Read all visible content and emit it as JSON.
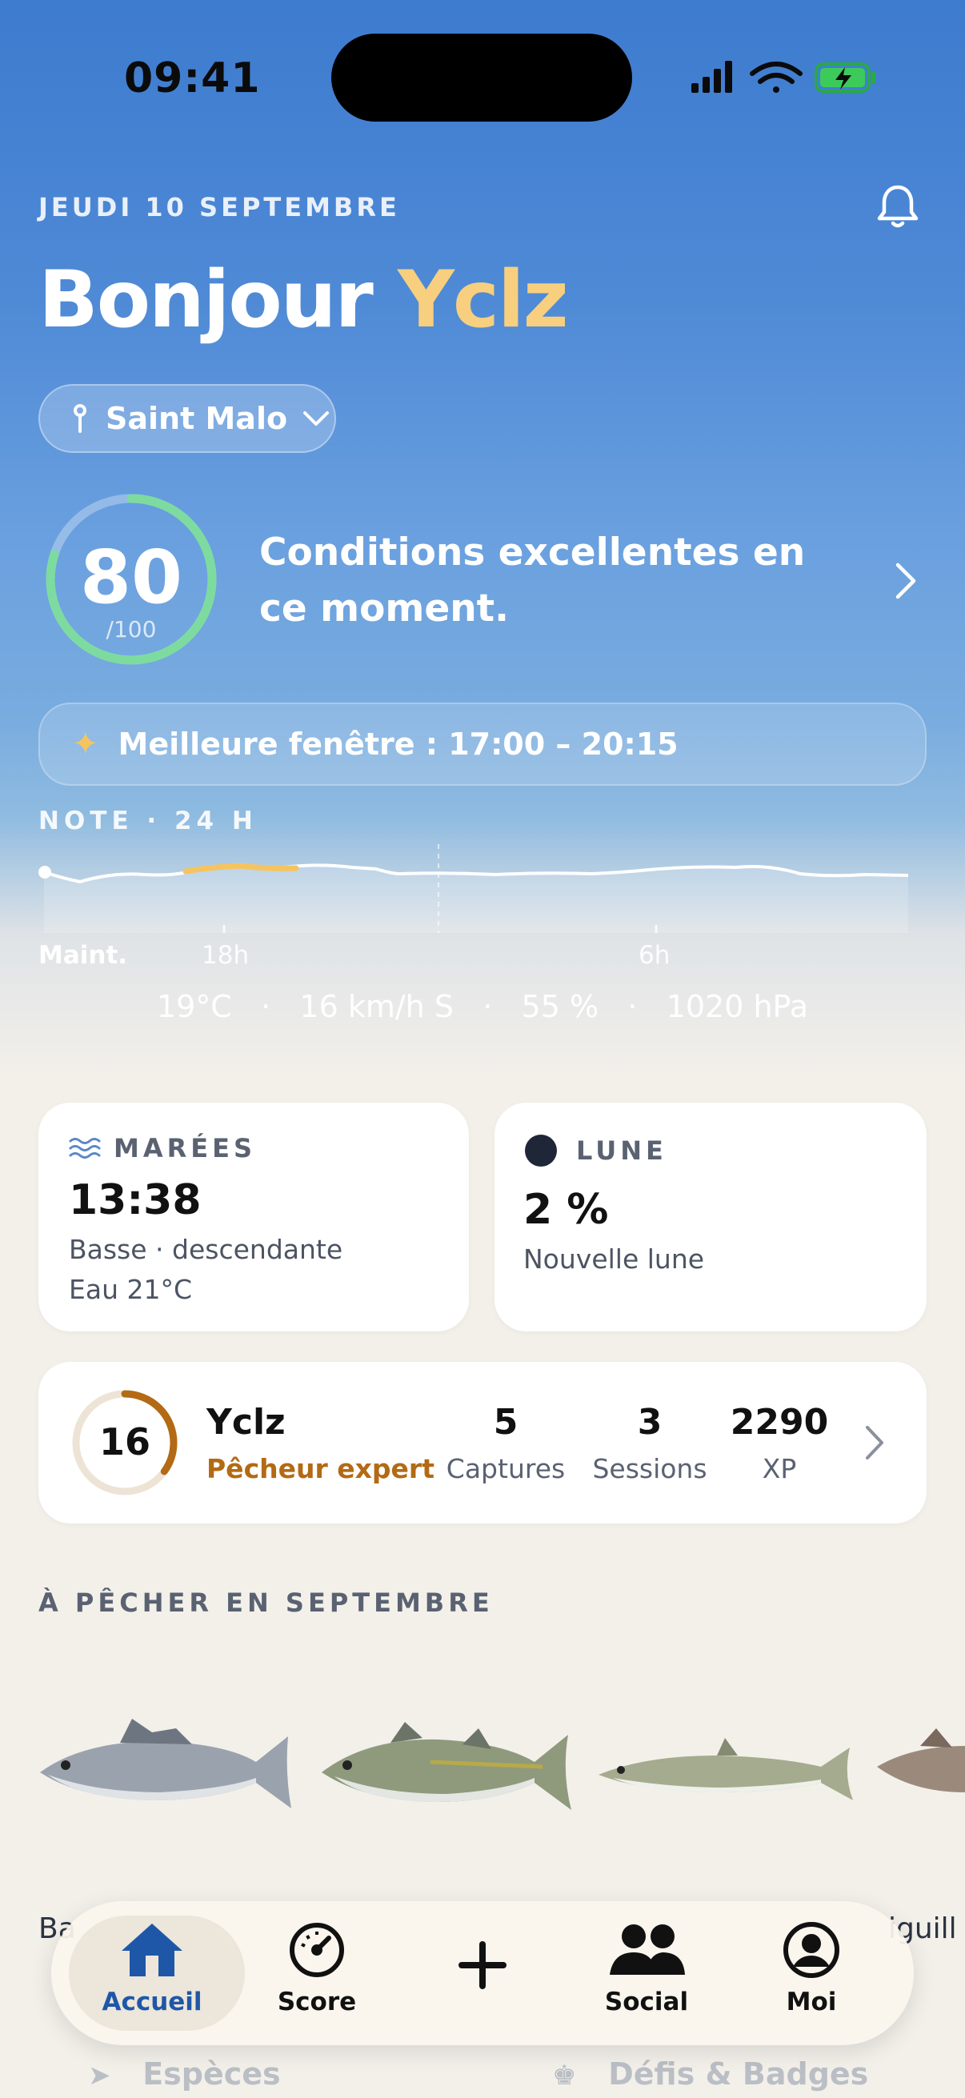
{
  "status_bar": {
    "time": "09:41"
  },
  "header": {
    "date": "JEUDI 10 SEPTEMBRE",
    "greeting": "Bonjour",
    "user_name": "Yclz",
    "location": "Saint Malo"
  },
  "score": {
    "value": "80",
    "denominator": "/100",
    "fraction": 0.8,
    "message": "Conditions excellentes en ce moment."
  },
  "best_window": {
    "label": "Meilleure fenêtre : 17:00 – 20:15"
  },
  "note_chart": {
    "title": "NOTE · 24 H",
    "tick_labels": [
      "Maint.",
      "18h",
      "6h"
    ]
  },
  "weather": {
    "temperature": "19°C",
    "wind": "16 km/h S",
    "humidity": "55 %",
    "pressure": "1020 hPa",
    "separator": "·"
  },
  "tides": {
    "label": "MARÉES",
    "time": "13:38",
    "state": "Basse · descendante",
    "water": "Eau 21°C"
  },
  "moon": {
    "label": "LUNE",
    "percent": "2 %",
    "phase": "Nouvelle lune"
  },
  "profile": {
    "level": "16",
    "level_progress": 0.35,
    "name": "Yclz",
    "rank": "Pêcheur expert",
    "stats": [
      {
        "value": "5",
        "label": "Captures"
      },
      {
        "value": "3",
        "label": "Sessions"
      },
      {
        "value": "2290",
        "label": "XP"
      }
    ]
  },
  "season": {
    "title": "À PÊCHER EN SEPTEMBRE",
    "fish_labels": [
      "Ba",
      "iguill"
    ]
  },
  "tabbar": {
    "tabs": [
      {
        "label": "Accueil",
        "icon": "home-icon"
      },
      {
        "label": "Score",
        "icon": "gauge-icon"
      },
      {
        "label": "",
        "icon": "plus-icon"
      },
      {
        "label": "Social",
        "icon": "people-icon"
      },
      {
        "label": "Moi",
        "icon": "profile-icon"
      }
    ]
  },
  "behind_tabbar": {
    "left": "Espèces",
    "right": "Défis & Badges"
  },
  "colors": {
    "accent_gold": "#f7cf7e",
    "score_ring": "#7ddba0",
    "rank": "#b36a14",
    "active_tab": "#1f57a8"
  }
}
